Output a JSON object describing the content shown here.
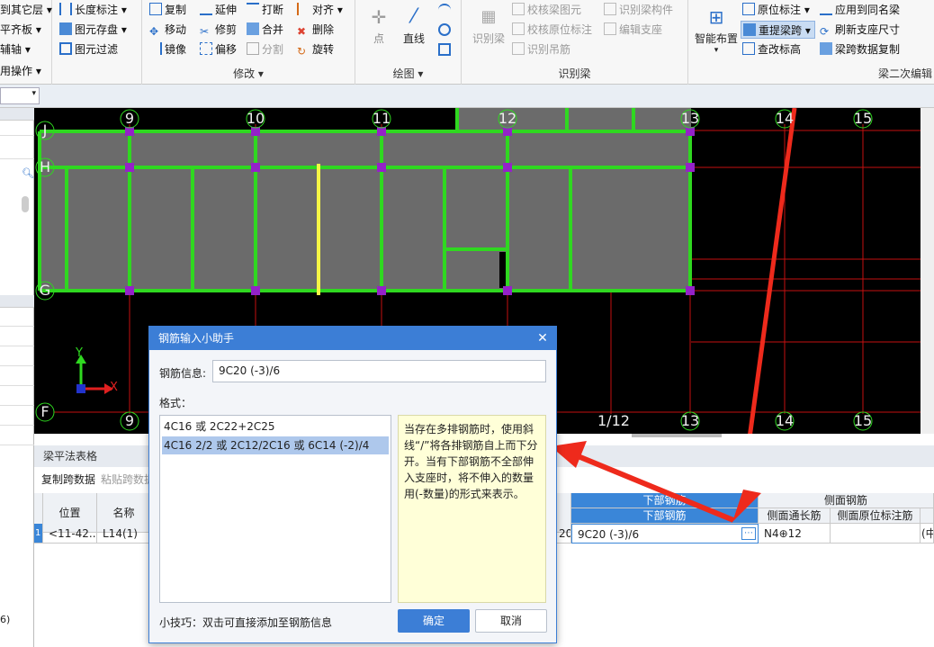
{
  "ribbon": {
    "g1": {
      "row1": "到其它层",
      "row2": "平齐板",
      "row3": "辅轴",
      "label": "用操作"
    },
    "g2": {
      "row1": "长度标注",
      "row2": "图元存盘",
      "row3": "图元过滤"
    },
    "modify": {
      "copy": "复制",
      "extend": "延伸",
      "break": "打断",
      "align": "对齐",
      "move": "移动",
      "trim": "修剪",
      "merge": "合并",
      "delete": "删除",
      "mirror": "镜像",
      "offset": "偏移",
      "split": "分割",
      "rotate": "旋转",
      "label": "修改"
    },
    "draw": {
      "point": "点",
      "line": "直线",
      "label": "绘图"
    },
    "identify": {
      "identify_beam": "识别梁",
      "check_beam": "校核梁图元",
      "identify_member": "识别梁构件",
      "check_orig": "校核原位标注",
      "edit_support": "编辑支座",
      "identify_hanger": "识别吊筋",
      "label": "识别梁"
    },
    "beam2": {
      "smart_layout": "智能布置",
      "orig_label": "原位标注",
      "apply_same": "应用到同名梁",
      "re_extract": "重提梁跨",
      "refresh_support": "刷新支座尺寸",
      "check_elev": "查改标高",
      "span_copy": "梁跨数据复制",
      "label": "梁二次编辑"
    }
  },
  "canvas": {
    "axis_top": [
      "9",
      "10",
      "11",
      "12",
      "13",
      "14",
      "15"
    ],
    "axis_bottom": [
      "9",
      "1/12",
      "13",
      "14",
      "15"
    ],
    "axis_left": [
      "J",
      "H",
      "G",
      "F"
    ],
    "coord_x": "X",
    "coord_y": "Y"
  },
  "table": {
    "title": "梁平法表格",
    "copy_span": "复制跨数据",
    "paste_span": "粘贴跨数据",
    "headers": {
      "position": "位置",
      "name": "名称",
      "bottom_group": "下部钢筋",
      "bottom": "下部钢筋",
      "side_group": "侧面钢筋",
      "side_through": "侧面通长筋",
      "side_orig": "侧面原位标注筋"
    },
    "row": {
      "index": "1",
      "position": "<11-42...",
      "name": "L14(1)",
      "partial": "20",
      "bottom_value": "9C20 (-3)/6",
      "side_through_value": "N4⊕12",
      "side_orig_value": "",
      "extra": "(中"
    },
    "left_bottom_text": "6)"
  },
  "dialog": {
    "title": "钢筋输入小助手",
    "info_label": "钢筋信息:",
    "info_value": "9C20 (-3)/6",
    "format_label": "格式：",
    "formats": [
      "4C16 或 2C22+2C25",
      "4C16 2/2 或 2C12/2C16 或 6C14 (-2)/4"
    ],
    "tip": "当存在多排钢筋时，使用斜线“/”将各排钢筋自上而下分开。当有下部钢筋不全部伸入支座时，将不伸入的数量用(-数量)的形式来表示。",
    "hint": "小技巧：双击可直接添加至钢筋信息",
    "ok": "确定",
    "cancel": "取消"
  },
  "colors": {
    "accent": "#3c7ed6",
    "beam": "#33dd22",
    "grid": "#cc1111",
    "node": "#9922cc",
    "highlight": "#f5f545"
  }
}
